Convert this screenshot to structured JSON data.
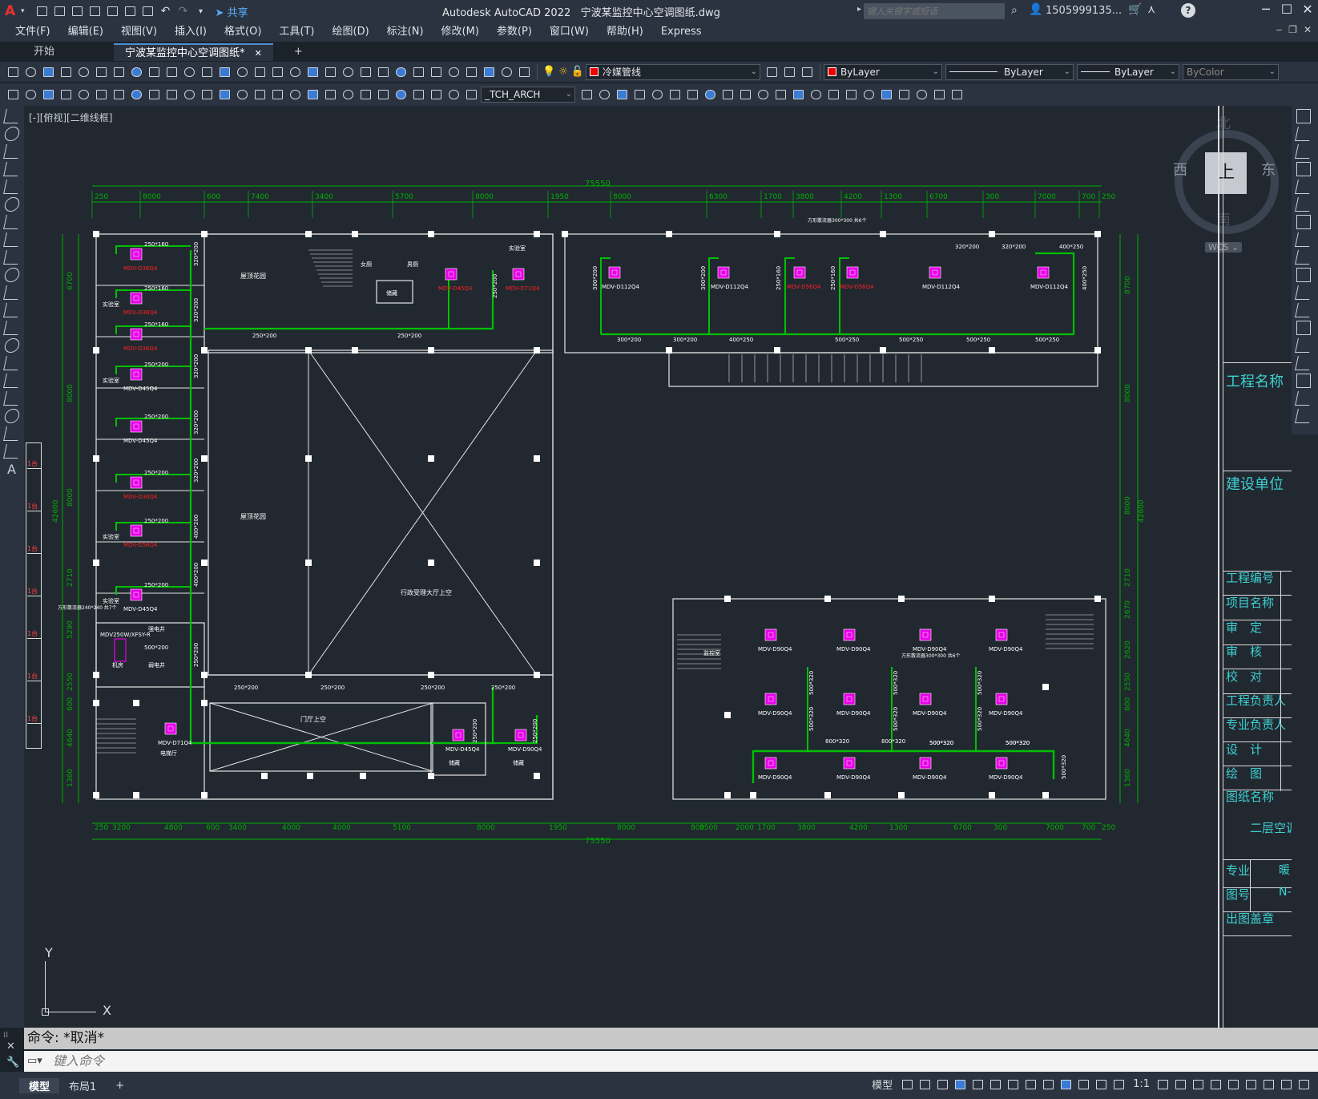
{
  "app": {
    "title": "Autodesk AutoCAD 2022",
    "filename": "宁波某监控中心空调图纸.dwg",
    "share_label": "共享",
    "search_placeholder": "键入关键字或短语",
    "user": "1505999135...",
    "help": "?"
  },
  "menu": [
    "文件(F)",
    "编辑(E)",
    "视图(V)",
    "插入(I)",
    "格式(O)",
    "工具(T)",
    "绘图(D)",
    "标注(N)",
    "修改(M)",
    "参数(P)",
    "窗口(W)",
    "帮助(H)",
    "Express"
  ],
  "tabs": {
    "start": "开始",
    "active": "宁波某监控中心空调图纸*",
    "close": "✕",
    "add": "+"
  },
  "toolbar": {
    "layer": "冷媒管线",
    "color": "ByLayer",
    "linetype": "ByLayer",
    "lineweight": "ByLayer",
    "plotstyle": "ByColor",
    "textstyle": "_TCH_ARCH"
  },
  "viewport": {
    "label": "[-][俯视][二维线框]",
    "compass": {
      "north": "北",
      "south": "南",
      "east": "东",
      "west": "西",
      "top": "上",
      "wcs": "WCS"
    },
    "ucs": {
      "x": "X",
      "y": "Y"
    }
  },
  "drawing": {
    "overall_dim": "75550",
    "top_dims": [
      "250",
      "8000",
      "600",
      "7400",
      "3400",
      "5700",
      "8000",
      "1950",
      "8000",
      "6300",
      "1700",
      "3800",
      "4200",
      "1300",
      "6700",
      "300",
      "7000",
      "700",
      "250"
    ],
    "bottom_dims": [
      "250",
      "3200",
      "4800",
      "600",
      "3400",
      "4000",
      "4000",
      "5100",
      "8000",
      "1950",
      "8000",
      "800",
      "3500",
      "2000",
      "1700",
      "3800",
      "4200",
      "1300",
      "6700",
      "300",
      "7000",
      "700",
      "250"
    ],
    "left_dims": [
      "6700",
      "8000",
      "8000",
      "2710",
      "5290",
      "2550",
      "600",
      "4640",
      "1360"
    ],
    "left_total": "42600",
    "right_dims": [
      "8700",
      "8000",
      "8000",
      "2710",
      "2670",
      "2620",
      "2550",
      "600",
      "4640",
      "1360"
    ],
    "right_total": "42600",
    "units_left": [
      {
        "name": "MDV-D36Q4",
        "red": true,
        "duct": "250*160"
      },
      {
        "name": "MDV-D36Q4",
        "red": true,
        "duct": "250*160",
        "room": "实验室"
      },
      {
        "name": "MDV-D36Q4",
        "red": true,
        "duct": "250*160"
      },
      {
        "name": "MDV-D45Q4",
        "red": false,
        "duct": "250*200",
        "room": "实验室"
      },
      {
        "name": "MDV-D45Q4",
        "red": false,
        "duct": "250*200"
      },
      {
        "name": "MDV-D36Q4",
        "red": true,
        "duct": "250*200"
      },
      {
        "name": "MDV-D56Q4",
        "red": true,
        "duct": "250*200",
        "room": "实验室"
      },
      {
        "name": "MDV-D45Q4",
        "red": false,
        "duct": "250*200",
        "room": "实验室"
      }
    ],
    "riser_labels": [
      "320*200",
      "320*200",
      "320*200",
      "320*200",
      "320*200",
      "400*200",
      "400*200",
      "250*200"
    ],
    "top_middle": {
      "rooms": [
        "屋顶花园",
        "女厕",
        "男厕",
        "储藏",
        "实验室"
      ],
      "units": [
        "MDV-D45Q4",
        "MDV-D71Q4"
      ],
      "ducts": [
        "250*200",
        "250*200",
        "250*200"
      ]
    },
    "top_right": {
      "units": [
        "MDV-D112Q4",
        "MDV-D112Q4",
        "MDV-D56Q4",
        "MDV-D56Q4",
        "MDV-D112Q4",
        "MDV-D112Q4"
      ],
      "ducts": [
        "300*200",
        "300*200",
        "400*250",
        "500*250",
        "500*250",
        "500*250",
        "500*250"
      ],
      "risers": [
        "300*200",
        "300*200",
        "250*160",
        "250*160",
        "400*250"
      ],
      "tops": [
        "320*200",
        "320*200",
        "400*250"
      ],
      "note": "方形散流器300*300 共6个"
    },
    "center": {
      "big": "行政受理大厅上空",
      "garden": "屋顶花园",
      "lobby": "门厅上空"
    },
    "bottom_middle": {
      "ducts": [
        "250*200",
        "250*200",
        "250*200",
        "250*200",
        "250*200",
        "250*200"
      ],
      "units": [
        "MDV-D45Q4",
        "MDV-D90Q4"
      ],
      "rooms": [
        "储藏",
        "储藏"
      ]
    },
    "left_bottom": {
      "unit": "MDV-D71Q4",
      "room": "电梯厅",
      "equip": "MDV250W/XFSY-R",
      "duct": "500*200",
      "rooms": [
        "强电井",
        "弱电井",
        "机房"
      ],
      "note": "方形散流器240*240 共7个"
    },
    "bottom_right": {
      "units": [
        "MDV-D90Q4",
        "MDV-D90Q4",
        "MDV-D90Q4",
        "MDV-D90Q4",
        "MDV-D90Q4",
        "MDV-D90Q4",
        "MDV-D90Q4",
        "MDV-D90Q4",
        "MDV-D90Q4",
        "MDV-D90Q4",
        "MDV-D90Q4",
        "MDV-D90Q4"
      ],
      "ducts": [
        "500*320",
        "500*320",
        "500*320",
        "500*320",
        "800*320",
        "800*320"
      ],
      "risers": [
        "500*320",
        "500*320",
        "500*320",
        "500*320",
        "500*320",
        "500*320",
        "500*320"
      ],
      "room": "监控室",
      "note": "方形散流器300*300 共6个"
    }
  },
  "titleblock": {
    "project_name": "工程名称",
    "owner": "建设单位",
    "project_no": "工程编号",
    "item_name": "项目名称",
    "approve": "审　定",
    "review": "审　核",
    "check": "校　对",
    "eng_lead": "工程负责人",
    "spec_lead": "专业负责人",
    "design": "设　计",
    "draw": "绘　图",
    "sheet_name": "图纸名称",
    "sheet_title": "二层空调",
    "discipline": "专业",
    "discipline_val": "暖",
    "sheet_no": "图号",
    "sheet_no_val": "N-",
    "stamp": "出图盖章"
  },
  "left_strip": [
    "1台",
    "1台",
    "1台",
    "1台",
    "1台",
    "1台",
    "1台"
  ],
  "command": {
    "history": "命令: *取消*",
    "placeholder": "键入命令"
  },
  "status": {
    "model": "模型",
    "layout1": "布局1",
    "model_btn": "模型",
    "scale": "1:1"
  },
  "colors": {
    "duct": "#00c000",
    "wall": "#e6e6e6",
    "unit": "#e600e6",
    "dim": "#00b000",
    "text_red": "#ff2020",
    "title_text": "#3fd0d0"
  }
}
